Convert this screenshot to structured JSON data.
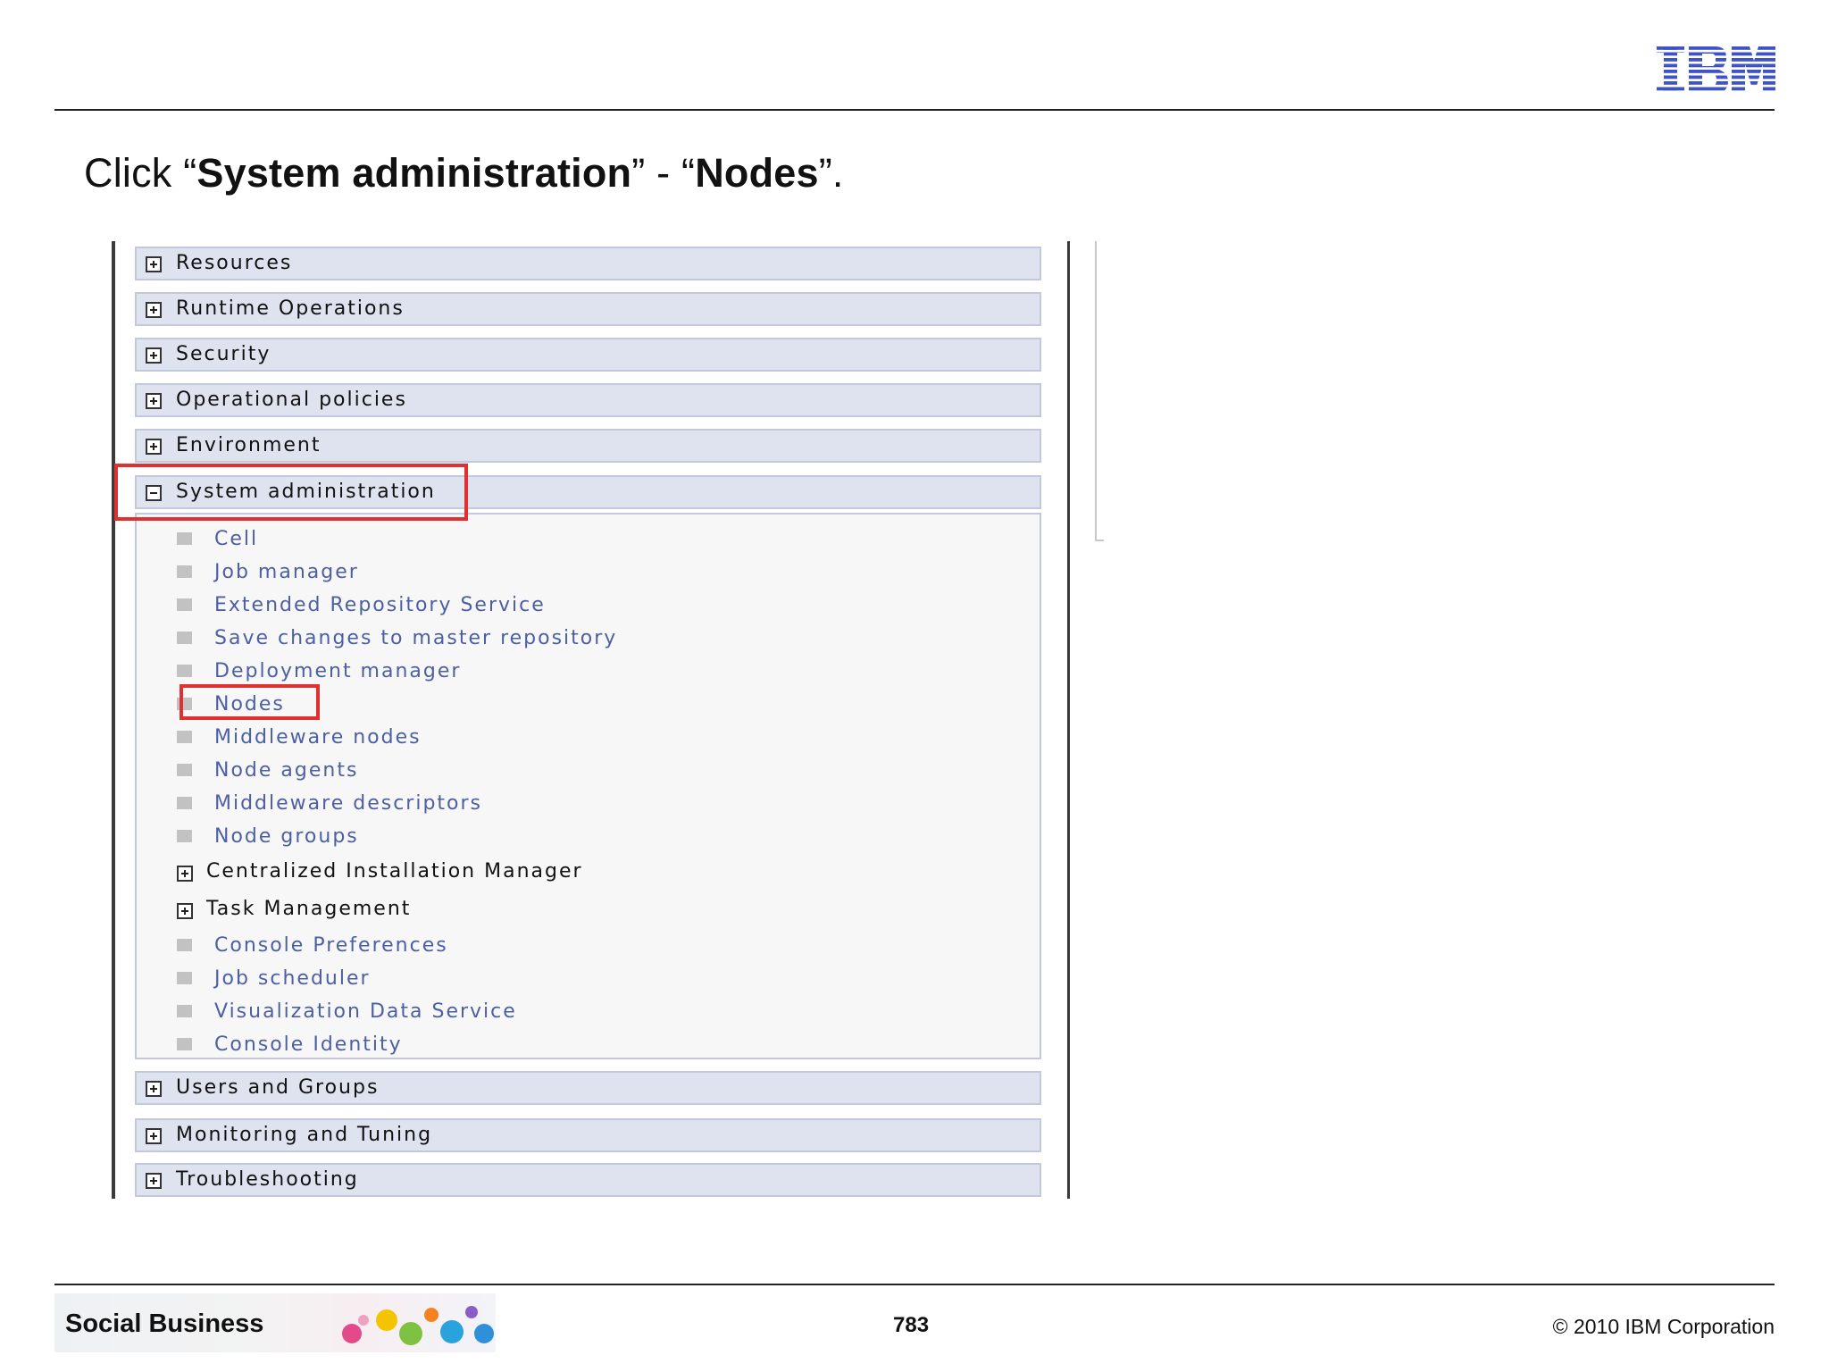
{
  "logo": {
    "text": "IBM",
    "color": "#3f53c8"
  },
  "instruction": {
    "prefix": "Click “",
    "item1": "System administration",
    "between": "” - “",
    "item2": "Nodes",
    "suffix": "”."
  },
  "nav": {
    "sections_top": [
      "Resources",
      "Runtime Operations",
      "Security",
      "Operational policies",
      "Environment"
    ],
    "expanded": {
      "label": "System administration",
      "links_a": [
        "Cell",
        "Job manager",
        "Extended Repository Service",
        "Save changes to master repository",
        "Deployment manager",
        "Nodes",
        "Middleware nodes",
        "Node agents",
        "Middleware descriptors",
        "Node groups"
      ],
      "groups": [
        "Centralized Installation Manager",
        "Task Management"
      ],
      "links_b": [
        "Console Preferences",
        "Job scheduler",
        "Visualization Data Service",
        "Console Identity"
      ]
    },
    "sections_bottom": [
      "Users and Groups",
      "Monitoring and Tuning",
      "Troubleshooting"
    ]
  },
  "footer": {
    "brand": "Social Business",
    "page_number": "783",
    "copyright": "© 2010 IBM Corporation"
  },
  "colors": {
    "section_bg": "#dfe3f0",
    "link": "#4d5fa3",
    "highlight": "#e03030"
  }
}
